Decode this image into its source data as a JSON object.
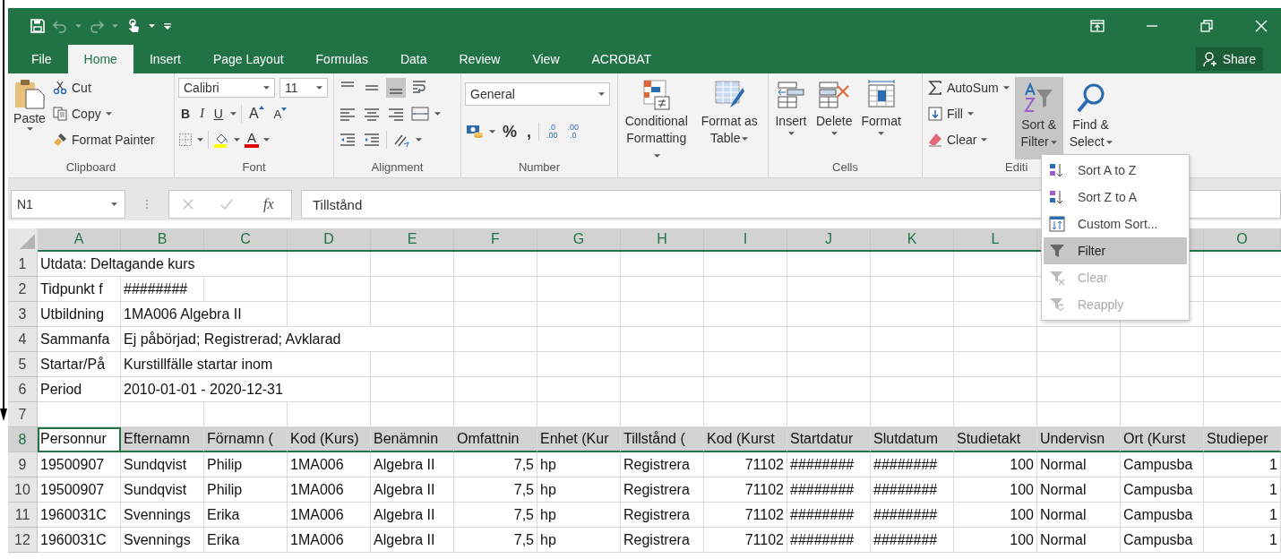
{
  "tabs": [
    {
      "label": "File",
      "selected": false
    },
    {
      "label": "Home",
      "selected": true
    },
    {
      "label": "Insert",
      "selected": false
    },
    {
      "label": "Page Layout",
      "selected": false
    },
    {
      "label": "Formulas",
      "selected": false
    },
    {
      "label": "Data",
      "selected": false
    },
    {
      "label": "Review",
      "selected": false
    },
    {
      "label": "View",
      "selected": false
    },
    {
      "label": "ACROBAT",
      "selected": false
    }
  ],
  "share_button": "Share",
  "ribbon": {
    "clipboard": {
      "label": "Clipboard",
      "paste": "Paste",
      "items": [
        "Cut",
        "Copy",
        "Format Painter"
      ]
    },
    "font": {
      "label": "Font",
      "font_name": "Calibri",
      "font_size": "11",
      "format_buttons": [
        "B",
        "I",
        "U"
      ],
      "size_buttons": [
        "A",
        "A"
      ],
      "color_button": "A"
    },
    "alignment": {
      "label": "Alignment"
    },
    "number": {
      "label": "Number",
      "format": "General",
      "buttons": [
        "%",
        ","
      ],
      "decimal_buttons": [
        [
          ".0",
          ".00"
        ],
        [
          ".00",
          ".0"
        ]
      ]
    },
    "styles": {
      "buttons": [
        "Conditional Formatting",
        "Format as Table"
      ]
    },
    "cells": {
      "label": "Cells",
      "buttons": [
        "Insert",
        "Delete",
        "Format"
      ]
    },
    "editing": {
      "label": "Editi",
      "small_buttons": [
        "AutoSum",
        "Fill",
        "Clear"
      ],
      "big_buttons": [
        {
          "label": "Sort & Filter",
          "pressed": true
        },
        {
          "label": "Find & Select",
          "pressed": false
        }
      ]
    }
  },
  "formula_bar": {
    "name_box": "N1",
    "function_label": "fx",
    "value": "Tillstånd"
  },
  "columns": [
    {
      "label": "A",
      "selected": true
    },
    {
      "label": "B",
      "selected": true
    },
    {
      "label": "C",
      "selected": true
    },
    {
      "label": "D",
      "selected": true
    },
    {
      "label": "E",
      "selected": true
    },
    {
      "label": "F",
      "selected": true
    },
    {
      "label": "G",
      "selected": true
    },
    {
      "label": "H",
      "selected": true
    },
    {
      "label": "I",
      "selected": true
    },
    {
      "label": "J",
      "selected": true
    },
    {
      "label": "K",
      "selected": true
    },
    {
      "label": "L",
      "selected": true
    },
    {
      "selected": true
    },
    {
      "selected": true
    },
    {
      "label": "O",
      "selected": true
    }
  ],
  "rows": [
    {
      "number": "1",
      "selected": false,
      "cells": {
        "A": {
          "text": "Utdata: Deltagande kurs",
          "kind": "text"
        }
      }
    },
    {
      "number": "2",
      "selected": false,
      "cells": {
        "A": {
          "text": "Tidpunkt f",
          "kind": "text"
        },
        "B": {
          "text": "########",
          "kind": "text"
        }
      }
    },
    {
      "number": "3",
      "selected": false,
      "cells": {
        "A": {
          "text": "Utbildning",
          "kind": "text"
        },
        "B": {
          "text": "1MA006 Algebra II",
          "kind": "text"
        }
      }
    },
    {
      "number": "4",
      "selected": false,
      "cells": {
        "A": {
          "text": "Sammanfa",
          "kind": "text"
        },
        "B": {
          "text": "Ej påbörjad; Registrerad; Avklarad",
          "kind": "text"
        }
      }
    },
    {
      "number": "5",
      "selected": false,
      "cells": {
        "A": {
          "text": "Startar/På",
          "kind": "text"
        },
        "B": {
          "text": "Kurstillfälle startar inom",
          "kind": "text"
        }
      }
    },
    {
      "number": "6",
      "selected": false,
      "cells": {
        "A": {
          "text": "Period",
          "kind": "text"
        },
        "B": {
          "text": "2010-01-01 - 2020-12-31",
          "kind": "text"
        }
      }
    },
    {
      "number": "7",
      "selected": false
    },
    {
      "number": "8",
      "selected": true,
      "cells": {
        "A": {
          "text": "Personnur",
          "kind": "text"
        },
        "B": {
          "text": "Efternamn",
          "kind": "text"
        },
        "C": {
          "text": "Förnamn (",
          "kind": "text"
        },
        "D": {
          "text": "Kod (Kurs)",
          "kind": "text"
        },
        "E": {
          "text": "Benämnin",
          "kind": "text"
        },
        "F": {
          "text": "Omfattnin",
          "kind": "text"
        },
        "G": {
          "text": "Enhet (Kur",
          "kind": "text"
        },
        "H": {
          "text": "Tillstånd (",
          "kind": "text"
        },
        "I": {
          "text": "Kod (Kurst",
          "kind": "text"
        },
        "J": {
          "text": "Startdatur",
          "kind": "text"
        },
        "K": {
          "text": "Slutdatum",
          "kind": "text"
        },
        "L": {
          "text": "Studietakt",
          "kind": "text"
        },
        "M": {
          "text": "Undervisn",
          "kind": "text"
        },
        "N": {
          "text": "Ort (Kurst",
          "kind": "text"
        },
        "O": {
          "text": "Studieper",
          "kind": "text"
        }
      }
    },
    {
      "number": "9",
      "selected": false,
      "cells": {
        "A": {
          "text": "19500907",
          "kind": "text"
        },
        "B": {
          "text": "Sundqvist",
          "kind": "text"
        },
        "C": {
          "text": "Philip",
          "kind": "text"
        },
        "D": {
          "text": "1MA006",
          "kind": "text"
        },
        "E": {
          "text": "Algebra II",
          "kind": "text"
        },
        "F": {
          "text": "7,5",
          "kind": "number"
        },
        "G": {
          "text": "hp",
          "kind": "text"
        },
        "H": {
          "text": "Registrera",
          "kind": "text"
        },
        "I": {
          "text": "71102",
          "kind": "number"
        },
        "J": {
          "text": "########",
          "kind": "text"
        },
        "K": {
          "text": "########",
          "kind": "text"
        },
        "L": {
          "text": "100",
          "kind": "number"
        },
        "M": {
          "text": "Normal",
          "kind": "text"
        },
        "N": {
          "text": "Campusba",
          "kind": "text"
        },
        "O": {
          "text": "1",
          "kind": "number"
        }
      }
    },
    {
      "number": "10",
      "selected": false,
      "cells": {
        "A": {
          "text": "19500907",
          "kind": "text"
        },
        "B": {
          "text": "Sundqvist",
          "kind": "text"
        },
        "C": {
          "text": "Philip",
          "kind": "text"
        },
        "D": {
          "text": "1MA006",
          "kind": "text"
        },
        "E": {
          "text": "Algebra II",
          "kind": "text"
        },
        "F": {
          "text": "7,5",
          "kind": "number"
        },
        "G": {
          "text": "hp",
          "kind": "text"
        },
        "H": {
          "text": "Registrera",
          "kind": "text"
        },
        "I": {
          "text": "71102",
          "kind": "number"
        },
        "J": {
          "text": "########",
          "kind": "text"
        },
        "K": {
          "text": "########",
          "kind": "text"
        },
        "L": {
          "text": "100",
          "kind": "number"
        },
        "M": {
          "text": "Normal",
          "kind": "text"
        },
        "N": {
          "text": "Campusba",
          "kind": "text"
        },
        "O": {
          "text": "1",
          "kind": "number"
        }
      }
    },
    {
      "number": "11",
      "selected": false,
      "cells": {
        "A": {
          "text": "1960031C",
          "kind": "text"
        },
        "B": {
          "text": "Svennings",
          "kind": "text"
        },
        "C": {
          "text": "Erika",
          "kind": "text"
        },
        "D": {
          "text": "1MA006",
          "kind": "text"
        },
        "E": {
          "text": "Algebra II",
          "kind": "text"
        },
        "F": {
          "text": "7,5",
          "kind": "number"
        },
        "G": {
          "text": "hp",
          "kind": "text"
        },
        "H": {
          "text": "Registrera",
          "kind": "text"
        },
        "I": {
          "text": "71102",
          "kind": "number"
        },
        "J": {
          "text": "########",
          "kind": "text"
        },
        "K": {
          "text": "########",
          "kind": "text"
        },
        "L": {
          "text": "100",
          "kind": "number"
        },
        "M": {
          "text": "Normal",
          "kind": "text"
        },
        "N": {
          "text": "Campusba",
          "kind": "text"
        },
        "O": {
          "text": "1",
          "kind": "number"
        }
      }
    },
    {
      "number": "12",
      "selected": false,
      "cells": {
        "A": {
          "text": "1960031C",
          "kind": "text"
        },
        "B": {
          "text": "Svennings",
          "kind": "text"
        },
        "C": {
          "text": "Erika",
          "kind": "text"
        },
        "D": {
          "text": "1MA006",
          "kind": "text"
        },
        "E": {
          "text": "Algebra II",
          "kind": "text"
        },
        "F": {
          "text": "7,5",
          "kind": "number"
        },
        "G": {
          "text": "hp",
          "kind": "text"
        },
        "H": {
          "text": "Registrera",
          "kind": "text"
        },
        "I": {
          "text": "71102",
          "kind": "number"
        },
        "J": {
          "text": "########",
          "kind": "text"
        },
        "K": {
          "text": "########",
          "kind": "text"
        },
        "L": {
          "text": "100",
          "kind": "number"
        },
        "M": {
          "text": "Normal",
          "kind": "text"
        },
        "N": {
          "text": "Campusba",
          "kind": "text"
        },
        "O": {
          "text": "1",
          "kind": "number"
        }
      }
    }
  ],
  "sort_menu": [
    {
      "label": "Sort A to Z",
      "kind": "ascending",
      "selected": false,
      "disabled": false
    },
    {
      "label": "Sort Z to A",
      "kind": "descending",
      "selected": false,
      "disabled": false
    },
    {
      "label": "Custom Sort...",
      "kind": "custom",
      "selected": false,
      "disabled": false
    },
    {
      "label": "Filter",
      "kind": "filter",
      "selected": true,
      "disabled": false
    },
    {
      "label": "Clear",
      "kind": "clear",
      "selected": false,
      "disabled": true
    },
    {
      "label": "Reapply",
      "kind": "reapply",
      "selected": false,
      "disabled": true
    }
  ]
}
